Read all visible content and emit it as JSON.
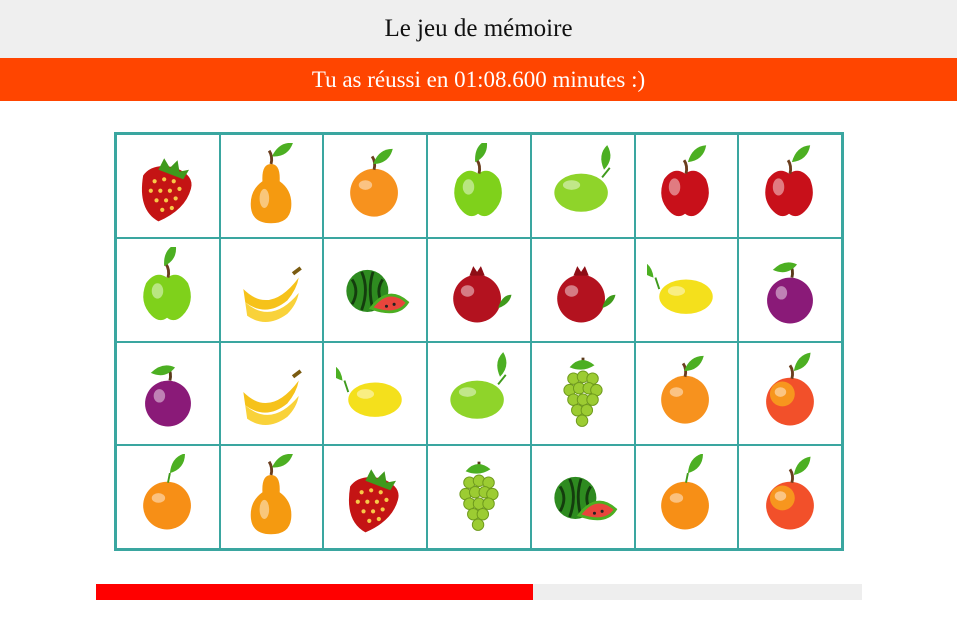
{
  "title": "Le jeu de mémoire",
  "status_message": "Tu as réussi en 01:08.600 minutes :)",
  "colors": {
    "banner": "#ff4500",
    "grid": "#3aa6a0",
    "progress": "#ff0000"
  },
  "progress": {
    "fraction": 0.57
  },
  "board": {
    "rows": 4,
    "cols": 7,
    "cards": [
      "strawberry",
      "pear",
      "orange",
      "green-apple",
      "lime",
      "red-apple",
      "red-apple",
      "green-apple",
      "banana",
      "watermelon",
      "pomegranate",
      "pomegranate",
      "lemon",
      "plum",
      "plum",
      "banana",
      "lemon",
      "lime",
      "grapes",
      "orange",
      "peach",
      "tangerine",
      "pear",
      "strawberry",
      "grapes",
      "watermelon",
      "tangerine",
      "peach"
    ]
  }
}
